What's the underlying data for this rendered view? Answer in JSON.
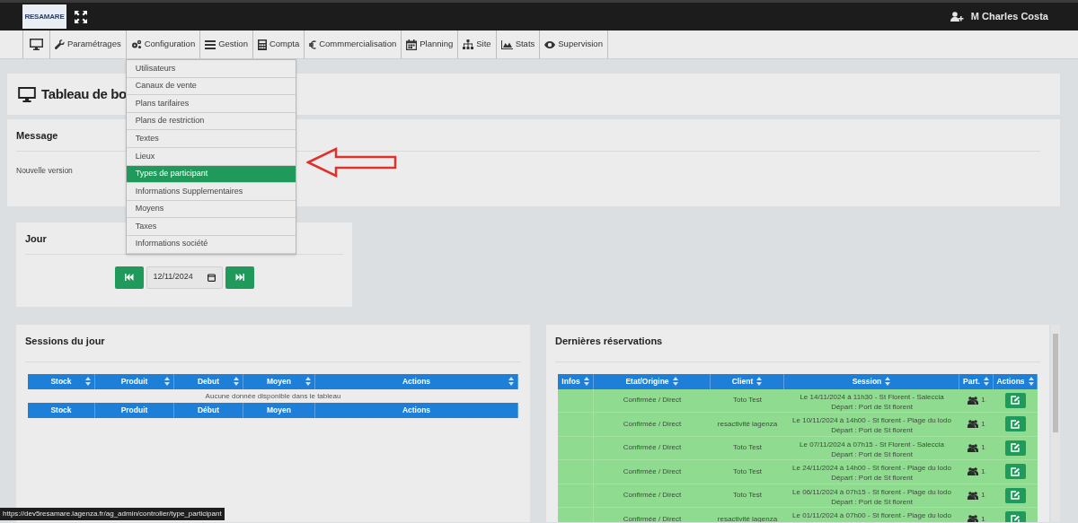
{
  "header": {
    "logo": "RESAMARE",
    "user": "M Charles Costa"
  },
  "nav": [
    {
      "label": "Paramétrages"
    },
    {
      "label": "Configuration",
      "submenu": [
        {
          "label": "Utilisateurs",
          "selected": false
        },
        {
          "label": "Canaux de vente",
          "selected": false
        },
        {
          "label": "Plans tarifaires",
          "selected": false
        },
        {
          "label": "Plans de restriction",
          "selected": false
        },
        {
          "label": "Textes",
          "selected": false
        },
        {
          "label": "Lieux",
          "selected": false
        },
        {
          "label": "Types de participant",
          "selected": true
        },
        {
          "label": "Informations Supplementaires",
          "selected": false
        },
        {
          "label": "Moyens",
          "selected": false
        },
        {
          "label": "Taxes",
          "selected": false
        },
        {
          "label": "Informations société",
          "selected": false
        }
      ]
    },
    {
      "label": "Gestion"
    },
    {
      "label": "Compta"
    },
    {
      "label": "Commmercialisation"
    },
    {
      "label": "Planning"
    },
    {
      "label": "Site"
    },
    {
      "label": "Stats"
    },
    {
      "label": "Supervision"
    }
  ],
  "page_title": "Tableau de bo",
  "message": {
    "title": "Message",
    "text": "Nouvelle version"
  },
  "jour": {
    "title": "Jour",
    "date": "12/11/2024"
  },
  "sessions": {
    "title": "Sessions du jour",
    "columns": [
      "Stock",
      "Produit",
      "Debut",
      "Moyen",
      "Actions"
    ],
    "empty": "Aucune donnée disponible dans le tableau",
    "footer": [
      "Stock",
      "Produit",
      "Début",
      "Moyen",
      "Actions"
    ]
  },
  "reservations": {
    "title": "Dernières réservations",
    "columns": [
      "Infos",
      "Etat/Origine",
      "Client",
      "Session",
      "Part.",
      "Actions"
    ],
    "rows": [
      {
        "etat": "Confirmée / Direct",
        "client": "Toto Test",
        "session": [
          "Le 14/11/2024 à 11h30 - St Florent - Saleccia",
          "Départ : Port de St florent"
        ],
        "part": "1"
      },
      {
        "etat": "Confirmée / Direct",
        "client": "resactivité lagenza",
        "session": [
          "Le 10/11/2024 à 14h00 - St florent - Plage du lodo",
          "Départ : Port de St florent"
        ],
        "part": "1"
      },
      {
        "etat": "Confirmée / Direct",
        "client": "Toto Test",
        "session": [
          "Le 07/11/2024 à 07h15 - St Florent - Saleccia",
          "Départ : Port de St florent"
        ],
        "part": "1"
      },
      {
        "etat": "Confirmée / Direct",
        "client": "Toto Test",
        "session": [
          "Le 24/11/2024 à 14h00 - St florent - Plage du lodo",
          "Départ : Port de St florent"
        ],
        "part": "1"
      },
      {
        "etat": "Confirmée / Direct",
        "client": "Toto Test",
        "session": [
          "Le 06/11/2024 à 07h15 - St florent - Plage du lodo",
          "Départ : Port de St florent"
        ],
        "part": "1"
      },
      {
        "etat": "Confirmée / Direct",
        "client": "resactivité lagenza",
        "session": [
          "Le 01/11/2024 à 07h00 - St florent - Plage du lodo"
        ],
        "part": "1"
      }
    ]
  },
  "status_url": "https://dev5resamare.lagenza.fr/ag_admin/controller/type_participant"
}
